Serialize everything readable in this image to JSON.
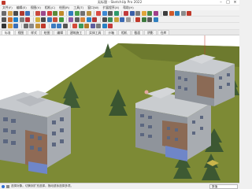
{
  "window": {
    "title": "无标题 - SketchUp Pro 2022"
  },
  "menu": [
    "文件(F)",
    "编辑(E)",
    "视图(V)",
    "相机(C)",
    "绘图(R)",
    "工具(T)",
    "窗口(W)",
    "扩展程序(X)",
    "帮助(H)"
  ],
  "tabs": [
    "标准",
    "视图",
    "样式",
    "绘图",
    "编辑",
    "建筑施工",
    "实体工具",
    "沙箱",
    "相机",
    "截面",
    "阴影",
    "仓库"
  ],
  "status": {
    "text": "选择对象。切换到扩充选择。拖动鼠标选择多项。",
    "measure_label": "数值"
  },
  "scene": {
    "ground_color": "#7d8a35",
    "sky_color": "#ffffff",
    "building_wall": "#8f949b",
    "building_window_blue": "#6f86c8"
  }
}
